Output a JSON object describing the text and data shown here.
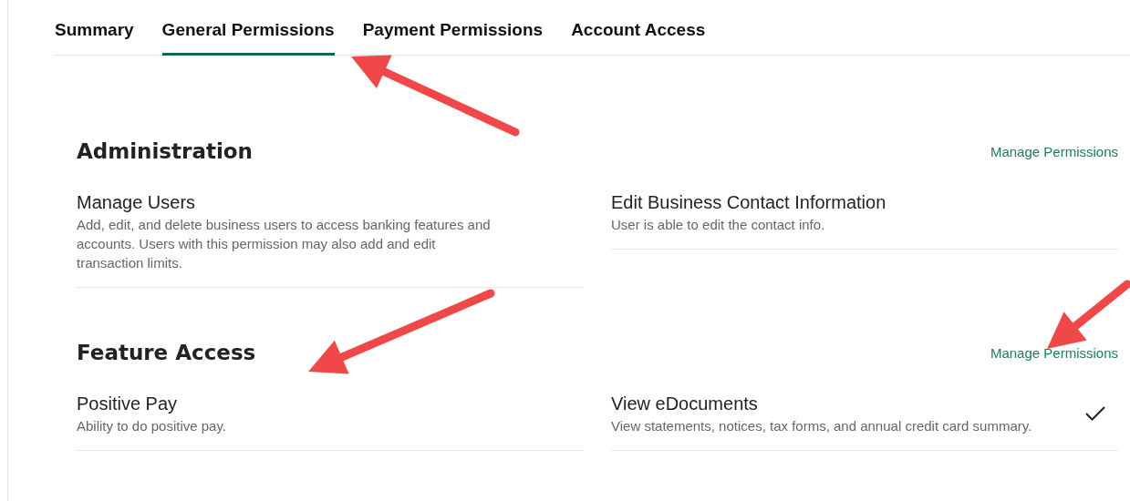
{
  "tabs": [
    {
      "label": "Summary",
      "selected": false
    },
    {
      "label": "General Permissions",
      "selected": true
    },
    {
      "label": "Payment Permissions",
      "selected": false
    },
    {
      "label": "Account Access",
      "selected": false
    }
  ],
  "sections": [
    {
      "title": "Administration",
      "link": "Manage Permissions",
      "items": [
        {
          "title": "Manage Users",
          "description": "Add, edit, and delete business users to access banking features and accounts. Users with this permission may also add and edit transaction limits.",
          "checked": false
        },
        {
          "title": "Edit Business Contact Information",
          "description": "User is able to edit the contact info.",
          "checked": false
        }
      ]
    },
    {
      "title": "Feature Access",
      "link": "Manage Permissions",
      "items": [
        {
          "title": "Positive Pay",
          "description": "Ability to do positive pay.",
          "checked": false
        },
        {
          "title": "View eDocuments",
          "description": "View statements, notices, tax forms, and annual credit card summary.",
          "checked": true
        }
      ]
    }
  ],
  "annotations": [
    {
      "kind": "arrow"
    },
    {
      "kind": "arrow"
    },
    {
      "kind": "arrow"
    }
  ]
}
